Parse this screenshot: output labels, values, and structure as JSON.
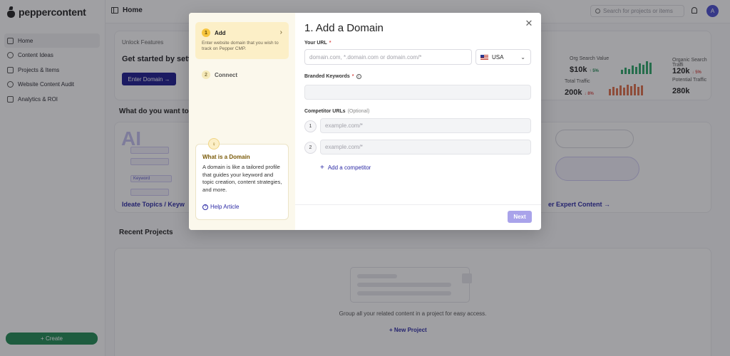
{
  "app": {
    "brand": "peppercontent",
    "page_title": "Home",
    "avatar_initial": "A"
  },
  "sidebar": {
    "items": [
      {
        "label": "Home",
        "icon": "home-icon",
        "active": true
      },
      {
        "label": "Content Ideas",
        "icon": "bulb-icon",
        "active": false
      },
      {
        "label": "Projects & Items",
        "icon": "folder-icon",
        "active": false
      },
      {
        "label": "Website Content Audit",
        "icon": "globe-icon",
        "active": false
      },
      {
        "label": "Analytics & ROI",
        "icon": "chart-icon",
        "active": false
      }
    ],
    "create_label": "+ Create"
  },
  "topbar": {
    "search_placeholder": "Search for projects or items"
  },
  "dashboard": {
    "unlock_label": "Unlock Features",
    "unlock_heading": "Get started by sett",
    "enter_domain_label": "Enter Domain →",
    "metrics": [
      {
        "label": "Org Search Value",
        "value": "$10k",
        "delta": "↑ 5%"
      },
      {
        "label": "Organic Search Traffi",
        "value": "120k",
        "delta": "↓ 5%"
      },
      {
        "label": "Total Traffic",
        "value": "200k",
        "delta": "↓ 8%"
      },
      {
        "label": "Potential Traffic",
        "value": "280k",
        "delta": ""
      }
    ],
    "what_title": "What do you want to",
    "ideate_link": "Ideate Topics / Keyw",
    "expert_link": "er Expert Content →",
    "ghost_keyword": "Keyword",
    "ai_text": "AI",
    "recent_title": "Recent Projects",
    "projects_empty": "Group all your related content in a project for easy access.",
    "new_project_label": "+ New Project"
  },
  "modal": {
    "steps": [
      {
        "num": "1",
        "name": "Add",
        "desc": "Enter website domain that you wish to track on Pepper CMP.",
        "active": true
      },
      {
        "num": "2",
        "name": "Connect",
        "desc": "",
        "active": false
      }
    ],
    "info": {
      "title": "What is a Domain",
      "body": "A domain is like a tailored profile that guides your keyword and topic creation, content strategies, and more.",
      "help_label": "Help Article"
    },
    "title": "1. Add a Domain",
    "url_label": "Your URL",
    "url_placeholder": "domain.com, *.domain.com or domain.com/*",
    "country": "USA",
    "keywords_label": "Branded Keywords",
    "keywords_value": "",
    "competitor_label": "Competitor URLs",
    "competitor_optional": "(Optional)",
    "competitors": [
      {
        "num": "1",
        "placeholder": "example.com/*"
      },
      {
        "num": "2",
        "placeholder": "example.com/*"
      }
    ],
    "add_competitor_label": "Add a competitor",
    "next_label": "Next"
  }
}
